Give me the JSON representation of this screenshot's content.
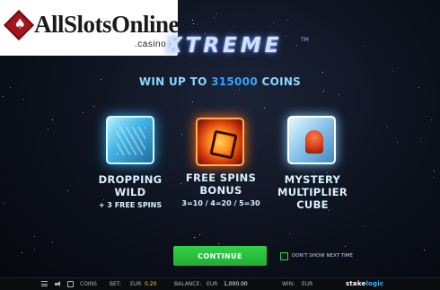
{
  "watermark": {
    "brand": "AllSlotsOnline",
    "suffix": ".casino"
  },
  "game": {
    "title": "XTREME",
    "trademark": "TM"
  },
  "headline": {
    "prefix": "WIN UP TO",
    "amount": "315000",
    "suffix": "COINS"
  },
  "features": [
    {
      "icon": "ice-cube-icon",
      "title_line1": "DROPPING",
      "title_line2": "WILD",
      "sub": "+ 3 FREE SPINS"
    },
    {
      "icon": "fire-cube-icon",
      "title_line1": "FREE SPINS",
      "title_line2": "BONUS",
      "sub": "3=10 / 4=20 / 5=30"
    },
    {
      "icon": "frozen-cube-icon",
      "title_line1": "MYSTERY",
      "title_line2": "MULTIPLIER",
      "title_line3": "CUBE"
    }
  ],
  "continue_label": "CONTINUE",
  "dont_show_label": "DON'T SHOW NEXT TIME",
  "bottom_bar": {
    "coins_label": "COINS",
    "bet_label": "BET:",
    "bet_currency": "EUR",
    "bet_value": "0.20",
    "balance_label": "BALANCE:",
    "balance_currency": "EUR",
    "balance_value": "1,000.00",
    "win_label": "WIN:",
    "win_currency": "EUR",
    "provider_part1": "stake",
    "provider_part2": "logic"
  },
  "colors": {
    "continue": "#1fae33",
    "headline": "#8ad7ff",
    "amount": "#36a4ff",
    "bet_value": "#ffd23a"
  }
}
